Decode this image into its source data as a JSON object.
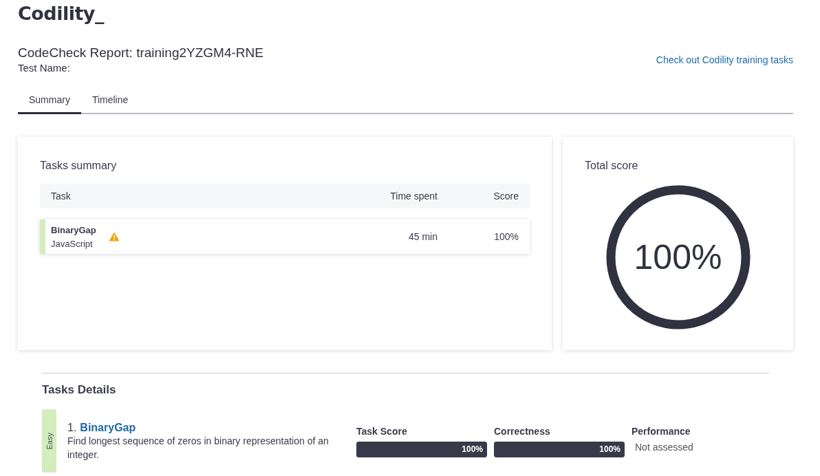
{
  "logo": "Codility_",
  "report": {
    "title": "CodeCheck Report: training2YZGM4-RNE",
    "test_name": "Test Name:",
    "link": "Check out Codility training tasks"
  },
  "tabs": [
    {
      "label": "Summary",
      "selected": true
    },
    {
      "label": "Timeline",
      "selected": false
    }
  ],
  "tasks_summary": {
    "title": "Tasks summary",
    "columns": [
      "Task",
      "Time spent",
      "Score"
    ],
    "rows": [
      {
        "name": "BinaryGap",
        "language": "JavaScript",
        "warning": true,
        "time": "45 min",
        "score": "100%",
        "color": "#d4edbc"
      }
    ]
  },
  "total_score": {
    "title": "Total score",
    "value": "100%",
    "level": 1
  },
  "tasks_details": {
    "title": "Tasks Details",
    "tasks": [
      {
        "difficulty": "Easy",
        "color": "#d4edbc",
        "number": "1.",
        "name": "BinaryGap",
        "description": "Find longest sequence of zeros in binary representation of an integer.",
        "metrics": [
          {
            "kind": "bar",
            "label": "Task Score",
            "level": 1,
            "reading": "100%"
          },
          {
            "kind": "bar",
            "label": "Correctness",
            "level": 1,
            "reading": "100%"
          },
          {
            "kind": "text",
            "label": "Performance",
            "value": "Not assessed"
          }
        ]
      }
    ]
  }
}
